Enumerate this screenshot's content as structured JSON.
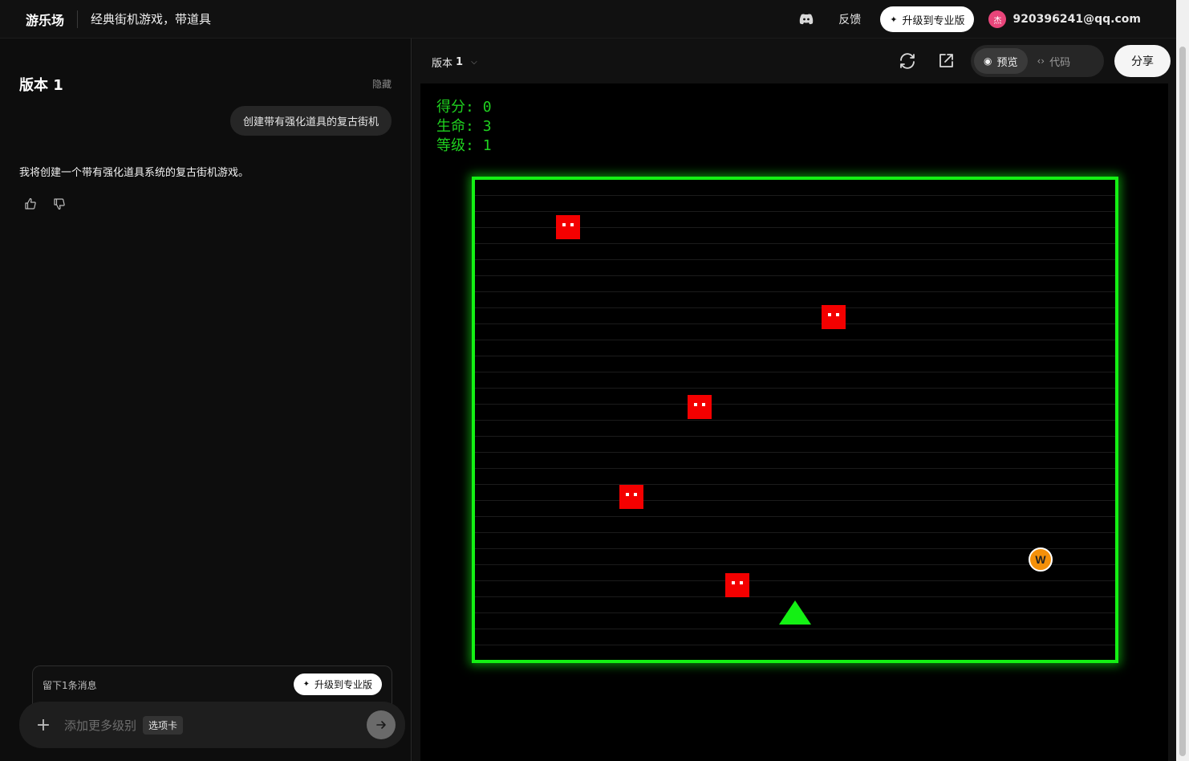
{
  "header": {
    "brand": "游乐场",
    "title": "经典街机游戏，带道具",
    "feedback": "反馈",
    "upgrade": "升级到专业版",
    "avatar_char": "杰",
    "email": "920396241@qq.com"
  },
  "left_panel": {
    "version_title": "版本 1",
    "hide": "隐藏",
    "user_message": "创建带有强化道具的复古街机",
    "assistant_message": "我将创建一个带有强化道具系统的复古街机游戏。",
    "remaining": "留下1条消息",
    "upgrade_small": "升级到专业版",
    "composer": {
      "placeholder": "添加更多级别",
      "chip": "选项卡"
    }
  },
  "right_panel": {
    "version_tab": "版本",
    "version_num": "1",
    "preview": "预览",
    "code": "代码",
    "share": "分享"
  },
  "game": {
    "score_label": "得分:",
    "score": "0",
    "lives_label": "生命:",
    "lives": "3",
    "level_label": "等级:",
    "level": "1",
    "powerup_letter": "W",
    "colors": {
      "border": "#14f014",
      "enemy": "#f40000",
      "player": "#14f014",
      "powerup": "#f4900a"
    }
  }
}
